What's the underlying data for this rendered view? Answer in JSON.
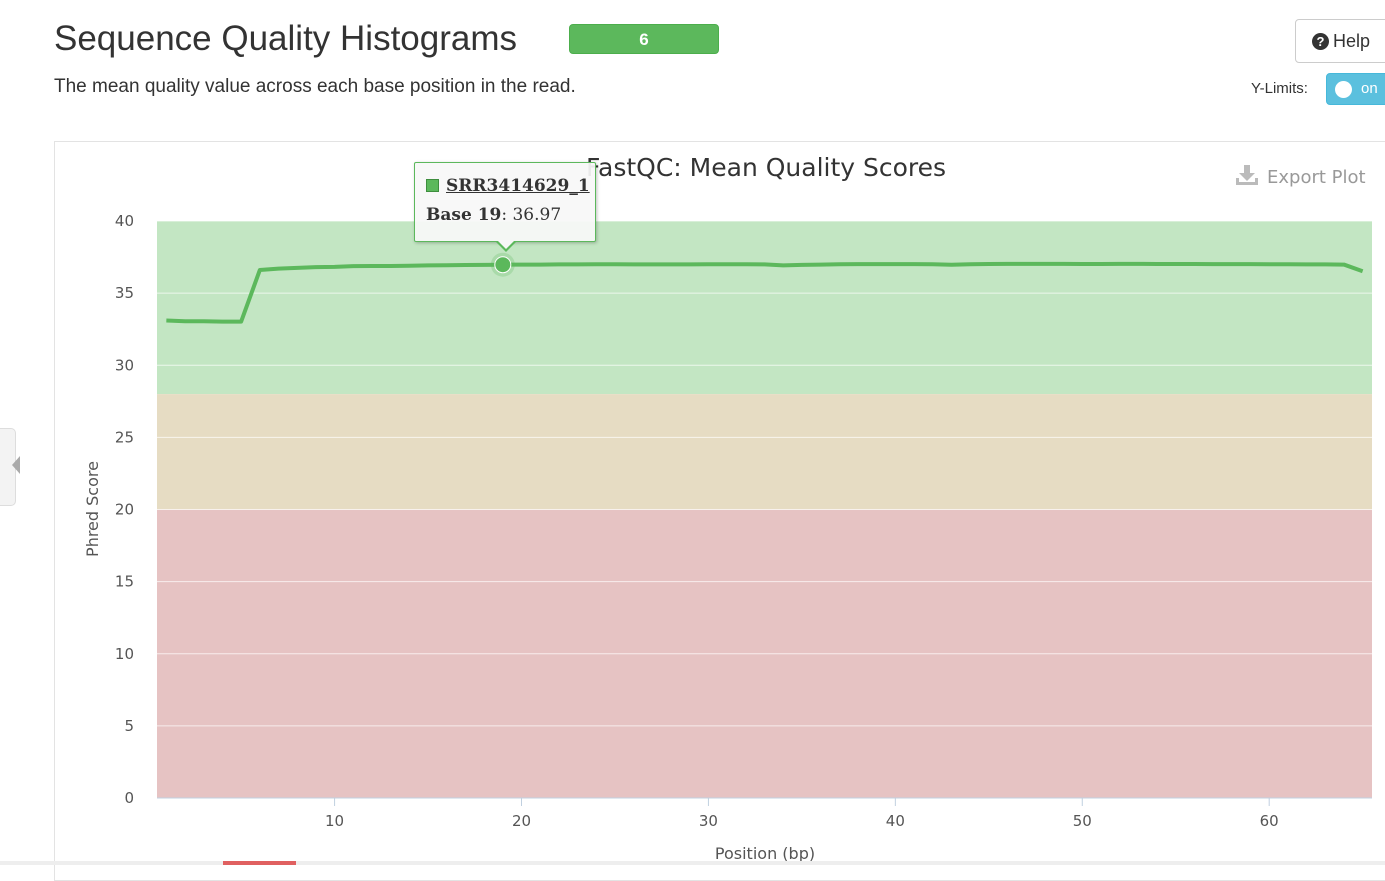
{
  "header": {
    "title": "Sequence Quality Histograms",
    "badge": "6",
    "subtitle": "The mean quality value across each base position in the read.",
    "help_label": "Help",
    "ylimits_label": "Y-Limits:",
    "ylimits_toggle": "on"
  },
  "plot": {
    "export_label": "Export Plot"
  },
  "tooltip": {
    "series": "SRR3414629_1",
    "label": "Base 19",
    "value": ": 36.97"
  },
  "colors": {
    "accent_green": "#5cb85c",
    "toggle_blue": "#5bc0de",
    "band_good": "#c3e6c3",
    "band_warn": "#e6dcc3",
    "band_fail": "#e6c3c3"
  },
  "chart_data": {
    "type": "line",
    "title": "FastQC: Mean Quality Scores",
    "xlabel": "Position (bp)",
    "ylabel": "Phred Score",
    "xlim": [
      0.5,
      65.5
    ],
    "ylim": [
      0,
      40
    ],
    "xticks": [
      10,
      20,
      30,
      40,
      50,
      60
    ],
    "yticks": [
      0,
      5,
      10,
      15,
      20,
      25,
      30,
      35,
      40
    ],
    "grid": true,
    "bands": [
      {
        "from": 28,
        "to": 40,
        "color": "#c3e6c3"
      },
      {
        "from": 20,
        "to": 28,
        "color": "#e6dcc3"
      },
      {
        "from": 0,
        "to": 20,
        "color": "#e6c3c3"
      }
    ],
    "series": [
      {
        "name": "SRR3414629_1",
        "color": "#5cb85c",
        "x": [
          1,
          2,
          3,
          4,
          5,
          6,
          7,
          8,
          9,
          10,
          11,
          12,
          13,
          14,
          15,
          16,
          17,
          18,
          19,
          20,
          21,
          22,
          23,
          24,
          25,
          26,
          27,
          28,
          29,
          30,
          31,
          32,
          33,
          34,
          35,
          36,
          37,
          38,
          39,
          40,
          41,
          42,
          43,
          44,
          45,
          46,
          47,
          48,
          49,
          50,
          51,
          52,
          53,
          54,
          55,
          56,
          57,
          58,
          59,
          60,
          61,
          62,
          63,
          64,
          65
        ],
        "y": [
          33.1,
          33.05,
          33.05,
          33.02,
          33.02,
          36.6,
          36.7,
          36.75,
          36.8,
          36.82,
          36.87,
          36.88,
          36.88,
          36.9,
          36.92,
          36.93,
          36.95,
          36.96,
          36.97,
          36.98,
          36.98,
          36.99,
          36.99,
          37.0,
          37.0,
          36.99,
          36.99,
          36.99,
          36.99,
          37.0,
          37.0,
          37.0,
          36.99,
          36.92,
          36.96,
          36.98,
          37.0,
          37.01,
          37.01,
          37.01,
          37.01,
          37.0,
          36.97,
          37.0,
          37.02,
          37.03,
          37.03,
          37.03,
          37.03,
          37.02,
          37.02,
          37.03,
          37.03,
          37.02,
          37.02,
          37.02,
          37.01,
          37.01,
          37.01,
          37.0,
          37.0,
          36.99,
          36.99,
          36.98,
          36.52
        ]
      }
    ],
    "highlight": {
      "series": "SRR3414629_1",
      "x": 19,
      "y": 36.97
    }
  }
}
